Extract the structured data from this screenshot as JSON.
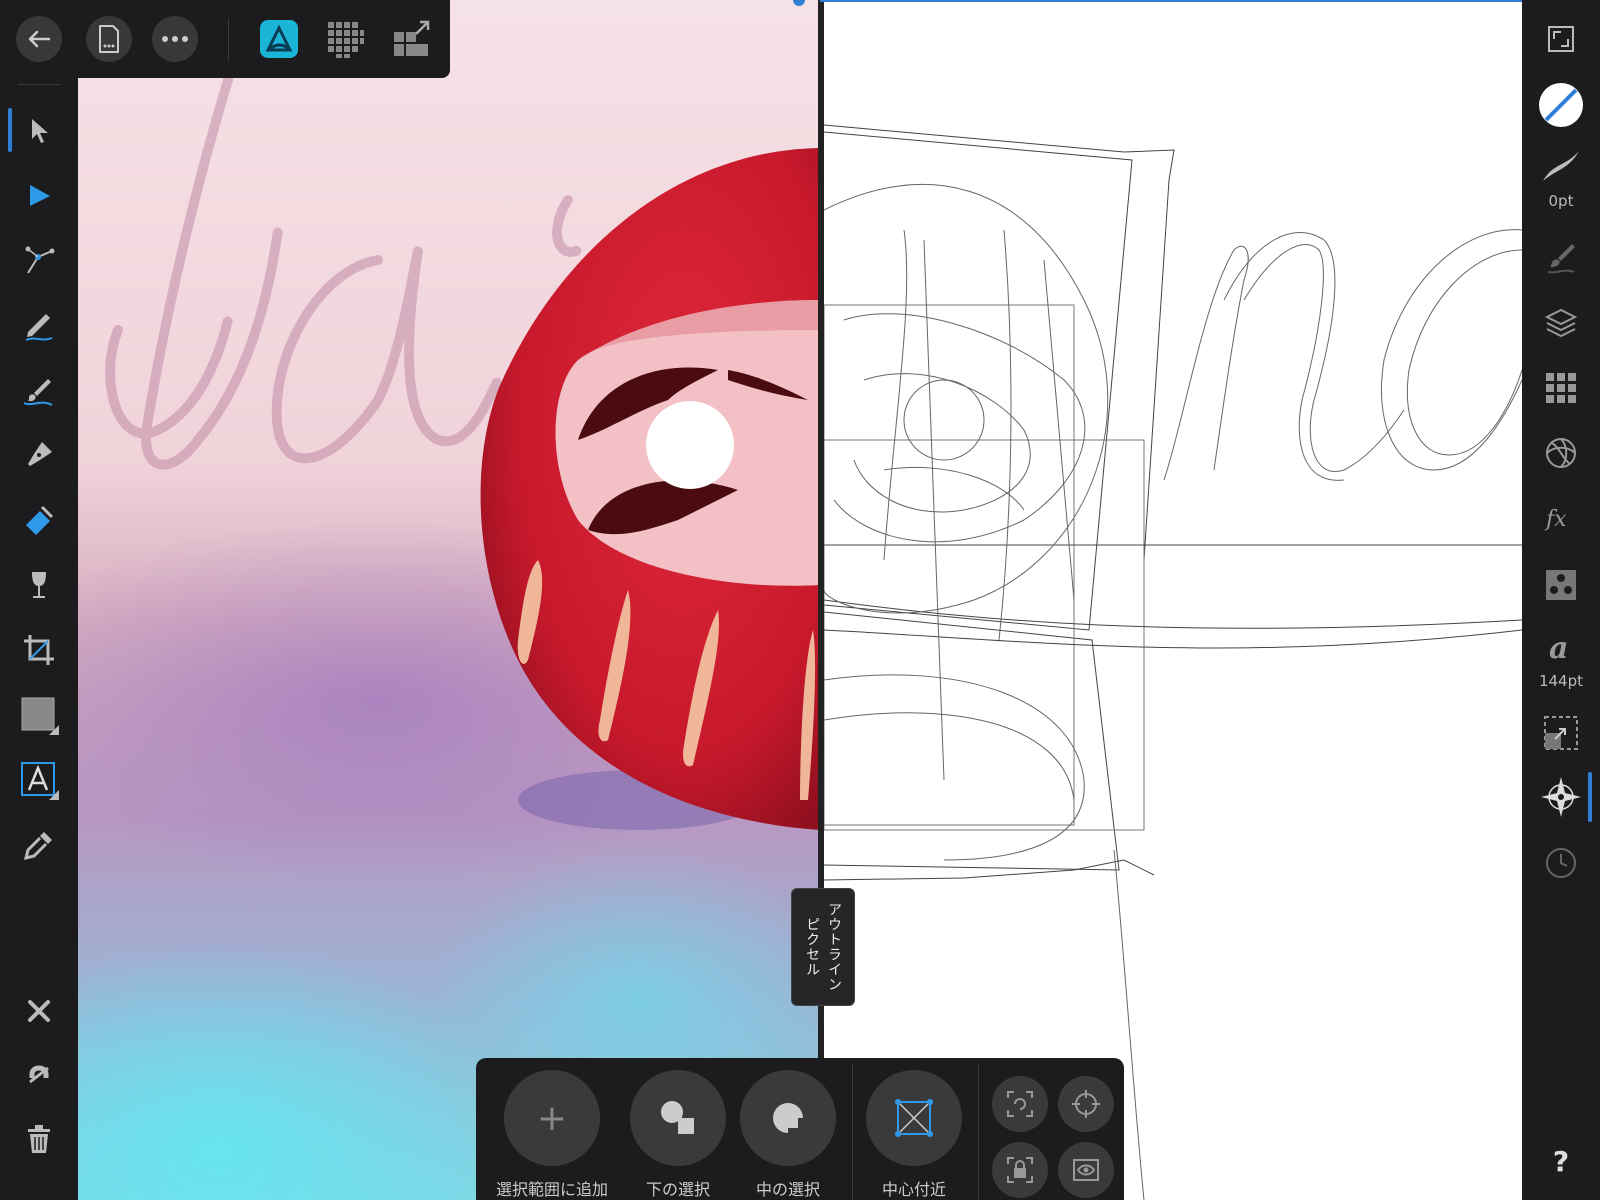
{
  "canvas": {
    "split_label_line1": "アウトライン",
    "split_label_line2": "ピクセル"
  },
  "top_toolbar": {
    "items": [
      "back-icon",
      "document-icon",
      "more-icon",
      "designer-persona-icon",
      "pixel-persona-icon",
      "export-persona-icon"
    ]
  },
  "left_toolbar": {
    "tools": [
      "move-tool",
      "node-tool",
      "corner-tool",
      "pencil-tool",
      "vector-brush-tool",
      "pen-tool",
      "fill-tool",
      "transparency-tool",
      "crop-tool",
      "shape-tool",
      "text-tool",
      "color-picker-tool"
    ],
    "active_tool": "move-tool",
    "actions": [
      "close-icon",
      "snapping-icon",
      "delete-icon"
    ]
  },
  "right_toolbar": {
    "stroke_width": "0pt",
    "font_size": "144pt",
    "panels": [
      "fullscreen-icon",
      "color-icon",
      "stroke-icon",
      "brushes-icon",
      "layers-icon",
      "swatches-icon",
      "color-wheel-icon",
      "effects-icon",
      "styles-icon",
      "text-styles-icon",
      "transform-icon",
      "navigator-icon",
      "history-icon",
      "help-icon"
    ],
    "active_panel": "navigator-icon",
    "help_label": "?"
  },
  "context_toolbar": {
    "add_to_selection": "選択範囲に追加",
    "add_symbol": "+",
    "select_under": "下の選択",
    "select_inside": "中の選択",
    "near_center": "中心付近"
  },
  "colors": {
    "accent": "#2f7fd6",
    "persona_active": "#1bb5d8",
    "toolbar_bg": "#1c1c1e",
    "button_bg": "#3a3a3c"
  }
}
